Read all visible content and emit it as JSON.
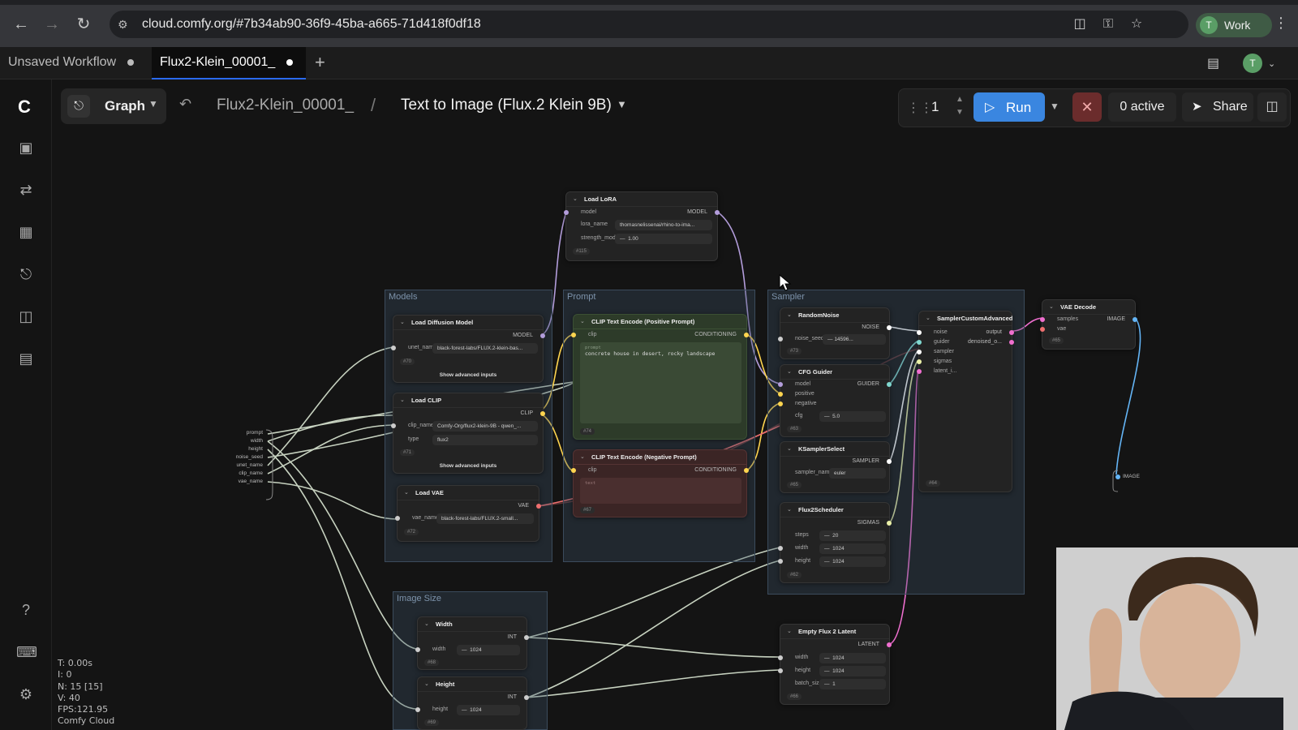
{
  "browser": {
    "url": "cloud.comfy.org/#7b34ab90-36f9-45ba-a665-71d418f0df18",
    "profile_label": "Work",
    "profile_initial": "T"
  },
  "tabs": [
    {
      "label": "Unsaved Workflow"
    },
    {
      "label": "Flux2-Klein_00001_"
    }
  ],
  "user_initial": "T",
  "toolbar": {
    "graph_label": "Graph",
    "breadcrumb_parent": "Flux2-Klein_00001_",
    "breadcrumb_separator": "/",
    "breadcrumb_current": "Text to Image (Flux.2 Klein 9B)",
    "batch_count": "1",
    "run_label": "Run",
    "active_label": "0 active",
    "share_label": "Share"
  },
  "stats": {
    "t": "T: 0.00s",
    "i": "I: 0",
    "n": "N: 15 [15]",
    "v": "V: 40",
    "fps": "FPS:121.95",
    "brand": "Comfy Cloud"
  },
  "groups": {
    "models": "Models",
    "prompt": "Prompt",
    "sampler": "Sampler",
    "image_size": "Image Size"
  },
  "inputs_panel": [
    "prompt",
    "width",
    "height",
    "noise_seed",
    "unet_name",
    "clip_name",
    "vae_name"
  ],
  "nodes": {
    "load_lora": {
      "title": "Load LoRA",
      "in_model": "model",
      "out_model": "MODEL",
      "lora_label": "lora_name",
      "lora_value": "thomasnelissenai/rhino-to-ima...",
      "strength_label": "strength_model",
      "strength_value": "1.00",
      "id": "#115"
    },
    "load_diffusion": {
      "title": "Load Diffusion Model",
      "out": "MODEL",
      "unet_label": "unet_name",
      "unet_value": "black-forest-labs/FLUX.2-klein-bas...",
      "id": "#70",
      "adv": "Show advanced inputs"
    },
    "load_clip": {
      "title": "Load CLIP",
      "out": "CLIP",
      "clip_label": "clip_name",
      "clip_value": "Comfy-Org/flux2-klein-9B - qwen_...",
      "type_label": "type",
      "type_value": "flux2",
      "id": "#71",
      "adv": "Show advanced inputs"
    },
    "load_vae": {
      "title": "Load VAE",
      "out": "VAE",
      "vae_label": "vae_name",
      "vae_value": "black-forest-labs/FLUX.2-small...",
      "id": "#72"
    },
    "clip_pos": {
      "title": "CLIP Text Encode (Positive Prompt)",
      "in": "clip",
      "out": "CONDITIONING",
      "placeholder": "prompt",
      "text": "concrete house in desert, rocky landscape",
      "id": "#74"
    },
    "clip_neg": {
      "title": "CLIP Text Encode (Negative Prompt)",
      "in": "clip",
      "out": "CONDITIONING",
      "placeholder": "text",
      "id": "#67"
    },
    "random_noise": {
      "title": "RandomNoise",
      "out": "NOISE",
      "seed_label": "noise_seed",
      "seed_value": "14596...",
      "id": "#73"
    },
    "cfg_guider": {
      "title": "CFG Guider",
      "out": "GUIDER",
      "in_model": "model",
      "in_pos": "positive",
      "in_neg": "negative",
      "cfg_label": "cfg",
      "cfg_value": "5.0",
      "id": "#63"
    },
    "ksampler_select": {
      "title": "KSamplerSelect",
      "out": "SAMPLER",
      "name_label": "sampler_name",
      "name_value": "euler",
      "id": "#65"
    },
    "flux2_scheduler": {
      "title": "Flux2Scheduler",
      "out": "SIGMAS",
      "steps_label": "steps",
      "steps_value": "20",
      "width_label": "width",
      "width_value": "1024",
      "height_label": "height",
      "height_value": "1024",
      "id": "#62"
    },
    "sampler_custom": {
      "title": "SamplerCustomAdvanced",
      "in_noise": "noise",
      "in_guider": "guider",
      "in_sampler": "sampler",
      "in_sigmas": "sigmas",
      "in_latent": "latent_i...",
      "out_output": "output",
      "out_denoised": "denoised_o...",
      "id": "#64"
    },
    "vae_decode": {
      "title": "VAE Decode",
      "in_samples": "samples",
      "in_vae": "vae",
      "out": "IMAGE",
      "id": "#65"
    },
    "empty_latent": {
      "title": "Empty Flux 2 Latent",
      "out": "LATENT",
      "width_label": "width",
      "width_value": "1024",
      "height_label": "height",
      "height_value": "1024",
      "batch_label": "batch_size",
      "batch_value": "1",
      "id": "#66"
    },
    "width_node": {
      "title": "Width",
      "out": "INT",
      "label": "width",
      "value": "1024",
      "id": "#68"
    },
    "height_node": {
      "title": "Height",
      "out": "INT",
      "label": "height",
      "value": "1024",
      "id": "#69"
    }
  },
  "output_label": "IMAGE",
  "colors": {
    "accent": "#3a86e0",
    "model_wire": "#b39ddb",
    "clip_wire": "#ffd54f",
    "vae_wire": "#ef6f6f",
    "latent_wire": "#f06fd0",
    "int_wire": "#c7d2c0",
    "sigmas_wire": "#eaf0a8",
    "image_wire": "#64b5f6"
  },
  "icons": {
    "back": "arrow-left-icon",
    "forward": "arrow-right-icon",
    "reload": "reload-icon",
    "install": "install-icon",
    "key": "key-icon",
    "star": "star-icon"
  }
}
